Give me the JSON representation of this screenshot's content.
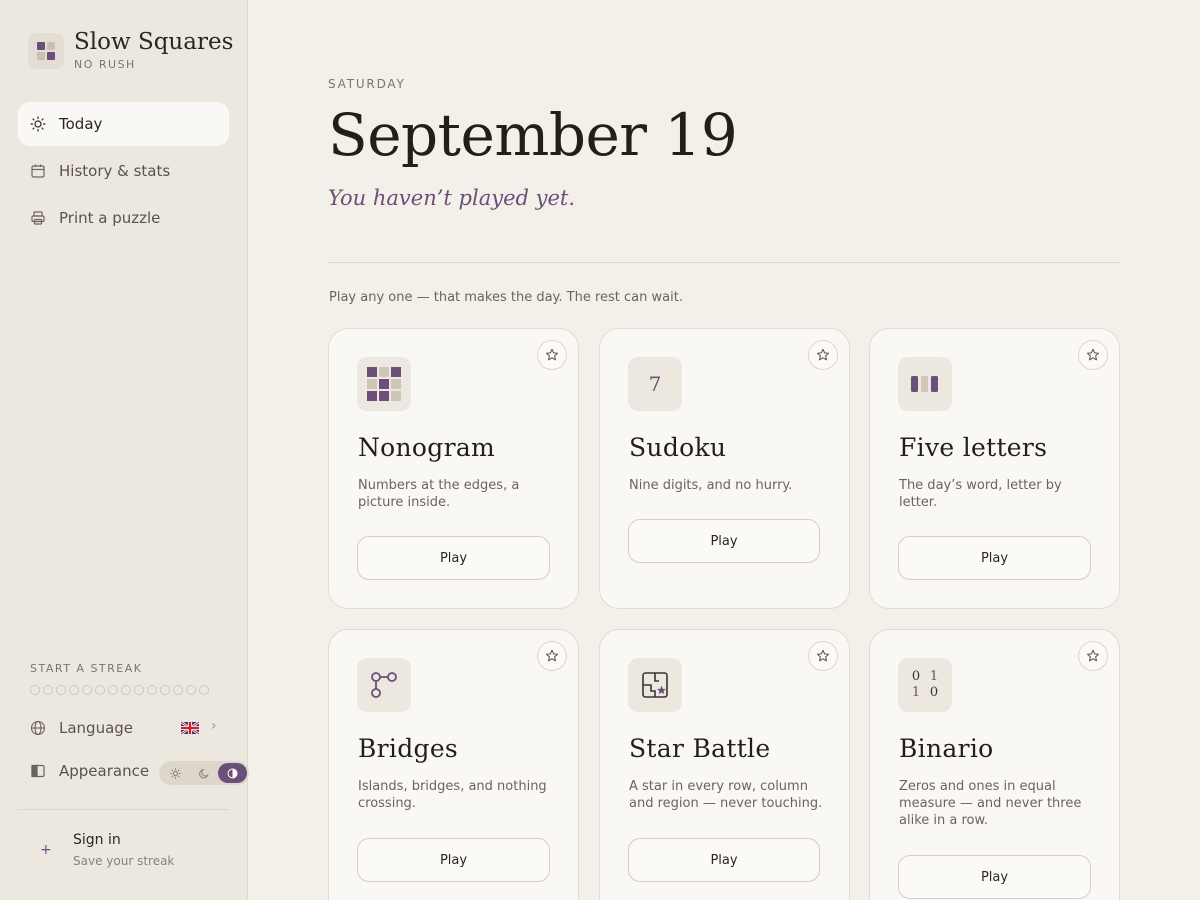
{
  "brand": {
    "title": "Slow Squares",
    "subtitle": "NO RUSH"
  },
  "nav": [
    {
      "label": "Today",
      "icon": "sun-icon",
      "active": true
    },
    {
      "label": "History & stats",
      "icon": "calendar-icon",
      "active": false
    },
    {
      "label": "Print a puzzle",
      "icon": "printer-icon",
      "active": false
    }
  ],
  "streak": {
    "label": "START A STREAK",
    "count": 0,
    "total": 14
  },
  "settings": {
    "language_label": "Language",
    "language_flag": "uk-flag-icon",
    "appearance_label": "Appearance",
    "appearance_options": [
      "light",
      "dark",
      "auto"
    ],
    "appearance_selected": "auto"
  },
  "account": {
    "signin_label": "Sign in",
    "signin_sub": "Save your streak",
    "plus": "+"
  },
  "header": {
    "day": "SATURDAY",
    "date": "September 19",
    "status": "You haven’t played yet.",
    "hint": "Play any one — that makes the day. The rest can wait."
  },
  "puzzles": [
    {
      "name": "Nonogram",
      "desc": "Numbers at the edges, a picture inside.",
      "play": "Play",
      "icon": "nonogram-grid-icon"
    },
    {
      "name": "Sudoku",
      "desc": "Nine digits, and no hurry.",
      "play": "Play",
      "icon": "sudoku-digit-icon",
      "glyph": "7"
    },
    {
      "name": "Five letters",
      "desc": "The day’s word, letter by letter.",
      "play": "Play",
      "icon": "letter-tiles-icon"
    },
    {
      "name": "Bridges",
      "desc": "Islands, bridges, and nothing crossing.",
      "play": "Play",
      "icon": "bridges-nodes-icon"
    },
    {
      "name": "Star Battle",
      "desc": "A star in every row, column and region — never touching.",
      "play": "Play",
      "icon": "star-battle-icon"
    },
    {
      "name": "Binario",
      "desc": "Zeros and ones in equal measure — and never three alike in a row.",
      "play": "Play",
      "icon": "binario-icon",
      "glyph": [
        "0",
        "1",
        "1",
        "0"
      ]
    }
  ],
  "colors": {
    "accent": "#6b4f7a",
    "background": "#f3f0ea",
    "sidebar": "#ede8df",
    "card": "#faf8f5"
  }
}
